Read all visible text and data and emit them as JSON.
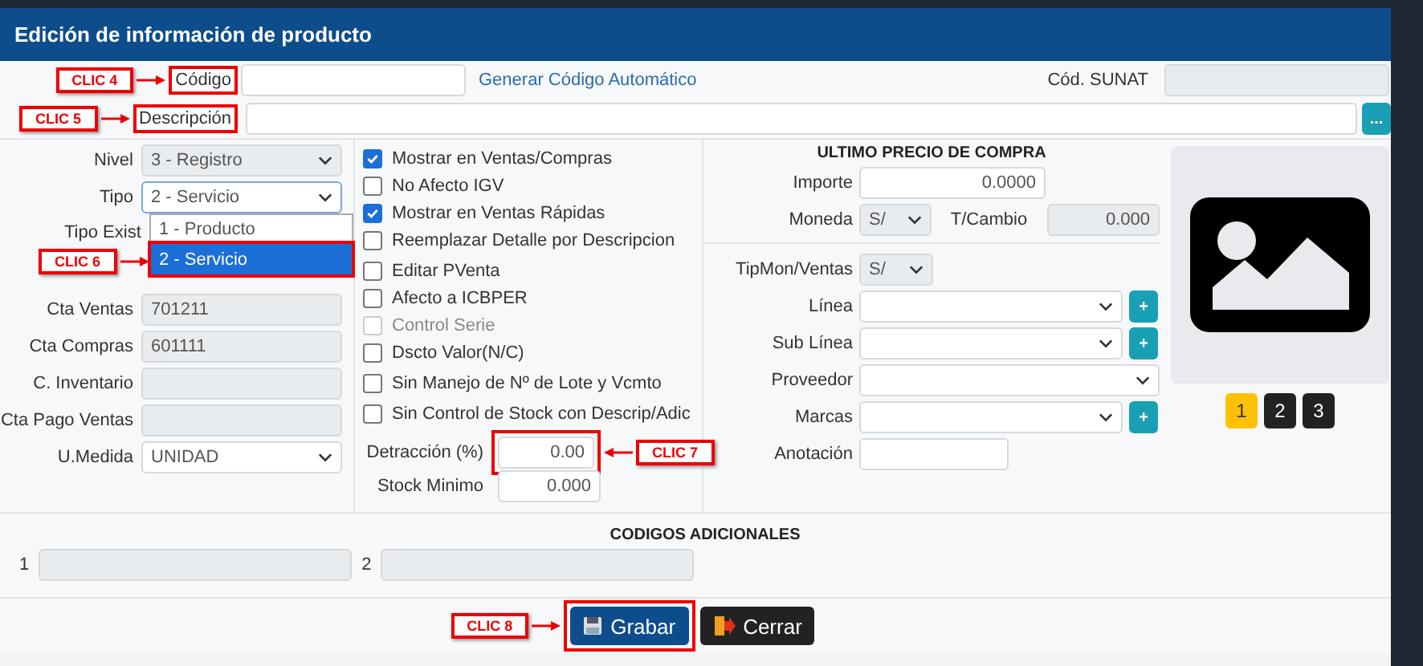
{
  "window": {
    "title": "Edición de información de producto"
  },
  "codigo": {
    "label": "Código",
    "callout": "CLIC 4",
    "link": "Generar Código Automático"
  },
  "sunat": {
    "label": "Cód. SUNAT",
    "disabled": true
  },
  "descripcion": {
    "label": "Descripción",
    "callout": "CLIC 5",
    "button": "..."
  },
  "left_fields": [
    {
      "label": "Nivel",
      "kind": "select",
      "value": "3 - Registro",
      "disabled": true
    },
    {
      "label": "Tipo",
      "kind": "select",
      "value": "2 - Servicio",
      "disabled": false,
      "expanded": true,
      "options": [
        {
          "label": "1 - Producto",
          "selected": false
        },
        {
          "label": "2 - Servicio",
          "selected": true,
          "callout": "CLIC 6"
        }
      ]
    },
    {
      "label": "Tipo Exist",
      "kind": "covered"
    },
    {
      "label": "Cta Ventas",
      "kind": "input",
      "value": "701211",
      "disabled": true
    },
    {
      "label": "Cta Compras",
      "kind": "input",
      "value": "601111",
      "disabled": true
    },
    {
      "label": "C. Inventario",
      "kind": "input",
      "disabled": true
    },
    {
      "label": "Cta Pago Ventas",
      "kind": "input",
      "disabled": true
    },
    {
      "label": "U.Medida",
      "kind": "select",
      "value": "UNIDAD",
      "disabled": false
    }
  ],
  "checkbox_groups": [
    [
      {
        "label": "Mostrar en Ventas/Compras",
        "checked": true,
        "disabled": false
      },
      {
        "label": "No Afecto IGV",
        "checked": false,
        "disabled": false
      },
      {
        "label": "Mostrar en Ventas Rápidas",
        "checked": true,
        "disabled": false
      },
      {
        "label": "Reemplazar Detalle por Descripcion",
        "checked": false,
        "disabled": false
      }
    ],
    [
      {
        "label": "Editar PVenta",
        "checked": false,
        "disabled": false
      },
      {
        "label": "Afecto a ICBPER",
        "checked": false,
        "disabled": false
      },
      {
        "label": "Control Serie",
        "checked": false,
        "disabled": true
      },
      {
        "label": "Dscto Valor(N/C)",
        "checked": false,
        "disabled": false
      }
    ],
    [
      {
        "label": "Sin Manejo de Nº de Lote y Vcmto",
        "checked": false,
        "disabled": false
      }
    ],
    [
      {
        "label": "Sin Control de Stock con Descrip/Adic",
        "checked": false,
        "disabled": false
      }
    ]
  ],
  "detraccion": {
    "label": "Detracción (%)",
    "value": "0.00",
    "callout": "CLIC 7"
  },
  "stock_minimo": {
    "label": "Stock Minimo",
    "value": "0.000"
  },
  "purchase": {
    "title": "ULTIMO PRECIO DE COMPRA",
    "importe": {
      "label": "Importe",
      "value": "0.0000"
    },
    "moneda": {
      "label": "Moneda",
      "value": "S/"
    },
    "t_cambio": {
      "label": "T/Cambio",
      "value": "0.000"
    }
  },
  "sales_fields": [
    {
      "label": "TipMon/Ventas",
      "kind": "small-select",
      "value": "S/"
    },
    {
      "label": "Línea",
      "kind": "select",
      "add_button": "+"
    },
    {
      "label": "Sub Línea",
      "kind": "select",
      "add_button": "+"
    },
    {
      "label": "Proveedor",
      "kind": "select"
    },
    {
      "label": "Marcas",
      "kind": "select",
      "add_button": "+"
    },
    {
      "label": "Anotación",
      "kind": "input"
    }
  ],
  "image_pages": [
    {
      "label": "1",
      "selected": true
    },
    {
      "label": "2",
      "selected": false
    },
    {
      "label": "3",
      "selected": false
    }
  ],
  "extra_codes": {
    "title": "CODIGOS ADICIONALES",
    "fields": [
      {
        "label": "1"
      },
      {
        "label": "2"
      }
    ]
  },
  "buttons": [
    {
      "label": "Grabar",
      "kind": "save",
      "callout": "CLIC 8"
    },
    {
      "label": "Cerrar",
      "kind": "close"
    }
  ]
}
